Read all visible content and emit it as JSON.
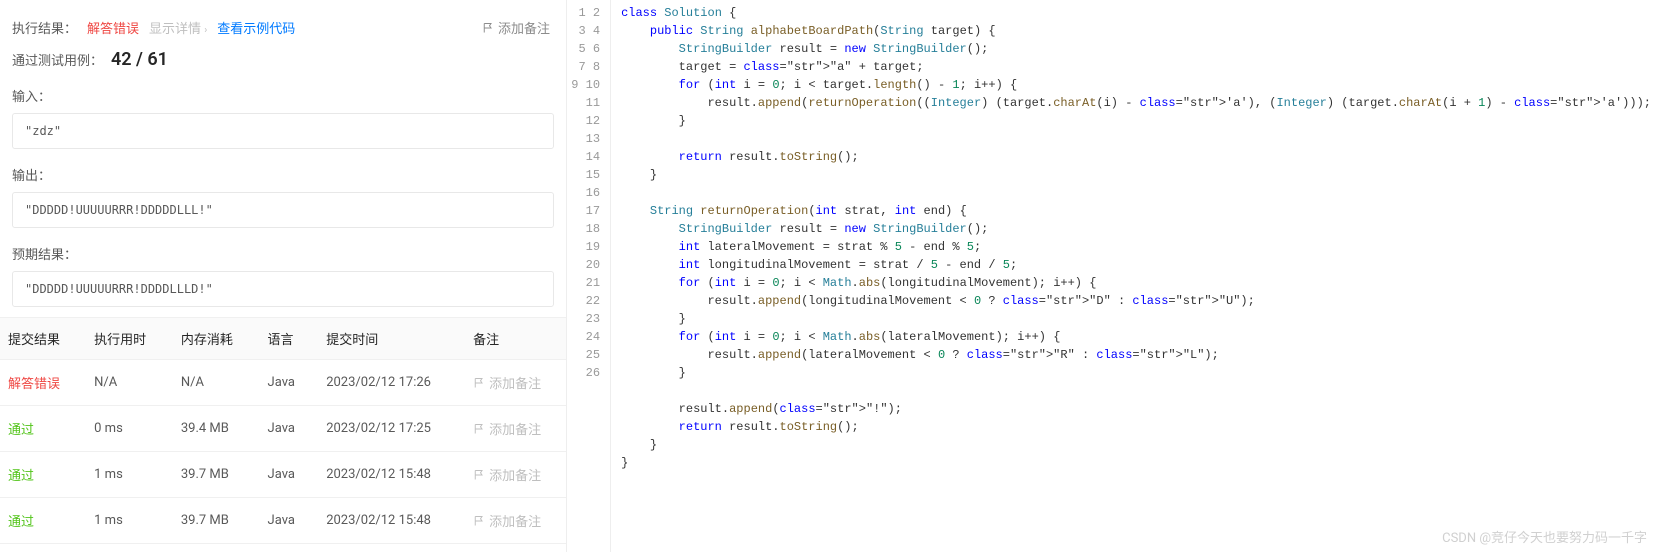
{
  "header": {
    "exec_result_label": "执行结果：",
    "status": "解答错误",
    "show_detail": "显示详情",
    "view_sample": "查看示例代码",
    "add_note": "添加备注"
  },
  "pass": {
    "label": "通过测试用例：",
    "count": "42 / 61"
  },
  "sections": {
    "input_label": "输入：",
    "input_value": "\"zdz\"",
    "output_label": "输出：",
    "output_value": "\"DDDDD!UUUUURRR!DDDDDLLL!\"",
    "expected_label": "预期结果：",
    "expected_value": "\"DDDDD!UUUUURRR!DDDDLLLD!\""
  },
  "table": {
    "headers": {
      "result": "提交结果",
      "runtime": "执行用时",
      "memory": "内存消耗",
      "lang": "语言",
      "time": "提交时间",
      "note": "备注"
    },
    "rows": [
      {
        "result": "解答错误",
        "result_class": "status-fail",
        "runtime": "N/A",
        "memory": "N/A",
        "lang": "Java",
        "time": "2023/02/12 17:26",
        "note": "添加备注"
      },
      {
        "result": "通过",
        "result_class": "status-pass",
        "runtime": "0 ms",
        "memory": "39.4 MB",
        "lang": "Java",
        "time": "2023/02/12 17:25",
        "note": "添加备注"
      },
      {
        "result": "通过",
        "result_class": "status-pass",
        "runtime": "1 ms",
        "memory": "39.7 MB",
        "lang": "Java",
        "time": "2023/02/12 15:48",
        "note": "添加备注"
      },
      {
        "result": "通过",
        "result_class": "status-pass",
        "runtime": "1 ms",
        "memory": "39.7 MB",
        "lang": "Java",
        "time": "2023/02/12 15:48",
        "note": "添加备注"
      }
    ]
  },
  "code": {
    "lines": [
      "class Solution {",
      "    public String alphabetBoardPath(String target) {",
      "        StringBuilder result = new StringBuilder();",
      "        target = \"a\" + target;",
      "        for (int i = 0; i < target.length() - 1; i++) {",
      "            result.append(returnOperation((Integer) (target.charAt(i) - 'a'), (Integer) (target.charAt(i + 1) - 'a')));",
      "        }",
      "",
      "        return result.toString();",
      "    }",
      "",
      "    String returnOperation(int strat, int end) {",
      "        StringBuilder result = new StringBuilder();",
      "        int lateralMovement = strat % 5 - end % 5;",
      "        int longitudinalMovement = strat / 5 - end / 5;",
      "        for (int i = 0; i < Math.abs(longitudinalMovement); i++) {",
      "            result.append(longitudinalMovement < 0 ? \"D\" : \"U\");",
      "        }",
      "        for (int i = 0; i < Math.abs(lateralMovement); i++) {",
      "            result.append(lateralMovement < 0 ? \"R\" : \"L\");",
      "        }",
      "",
      "        result.append(\"!\");",
      "        return result.toString();",
      "    }",
      "}"
    ]
  },
  "watermark": "CSDN @竞仔今天也要努力码一千字"
}
